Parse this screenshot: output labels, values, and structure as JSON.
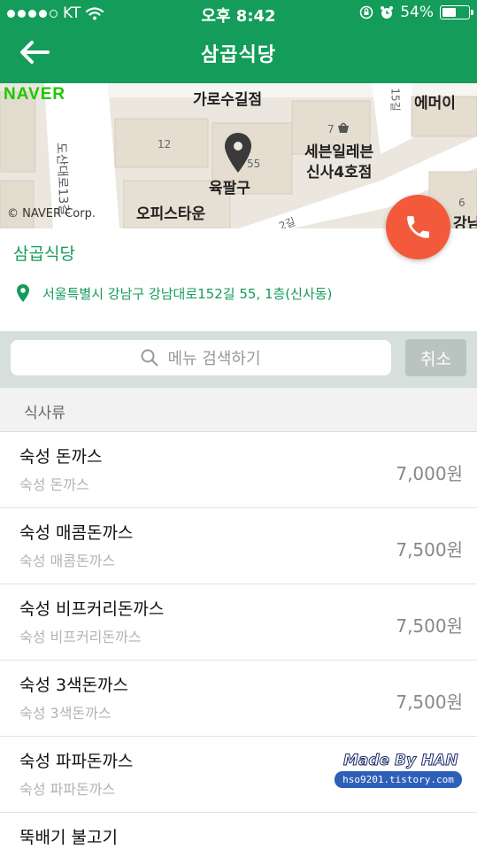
{
  "status_bar": {
    "carrier": "KT",
    "time": "오후 8:42",
    "battery_percent": "54%",
    "battery_level": 0.54,
    "signal_bars_filled": 4,
    "icons": [
      "wifi-icon",
      "rotation-lock-icon",
      "alarm-icon",
      "battery-icon"
    ]
  },
  "header": {
    "title": "삼곱식당",
    "back_icon": "arrow-left-icon",
    "background_color": "#149c5a"
  },
  "map": {
    "brand": "NAVER",
    "copyright": "© NAVER Corp.",
    "labels": {
      "place_1": "가로수길점",
      "place_2": "에머이",
      "place_3": "세븐일레븐",
      "place_4": "신사4호점",
      "place_5": "육팔구",
      "place_6": "오피스타운",
      "place_7": "강남",
      "road": "도산대로13길",
      "road_2": "15길",
      "road_3": "2길",
      "num_12": "12",
      "num_55": "55",
      "num_7": "7",
      "num_6": "6"
    },
    "marker_icon": "map-pin-icon"
  },
  "call_button": {
    "icon": "phone-icon",
    "color": "#f25a3b"
  },
  "info": {
    "name": "삼곱식당",
    "address": "서울특별시 강남구 강남대로152길 55, 1층(신사동)",
    "location_icon": "location-pin-icon",
    "accent_color": "#149c5a"
  },
  "search": {
    "placeholder": "메뉴 검색하기",
    "cancel_label": "취소",
    "icon": "search-icon"
  },
  "category": {
    "label": "식사류"
  },
  "menu": [
    {
      "name": "숙성 돈까스",
      "desc": "숙성 돈까스",
      "price": "7,000원"
    },
    {
      "name": "숙성 매콤돈까스",
      "desc": "숙성 매콤돈까스",
      "price": "7,500원"
    },
    {
      "name": "숙성 비프커리돈까스",
      "desc": "숙성 비프커리돈까스",
      "price": "7,500원"
    },
    {
      "name": "숙성 3색돈까스",
      "desc": "숙성 3색돈까스",
      "price": "7,500원"
    },
    {
      "name": "숙성 파파돈까스",
      "desc": "숙성 파파돈까스",
      "price": ""
    },
    {
      "name": "뚝배기 불고기",
      "desc": "",
      "price": ""
    }
  ],
  "watermark": {
    "title": "Made By HAN",
    "url": "hso9201.tistory.com"
  }
}
